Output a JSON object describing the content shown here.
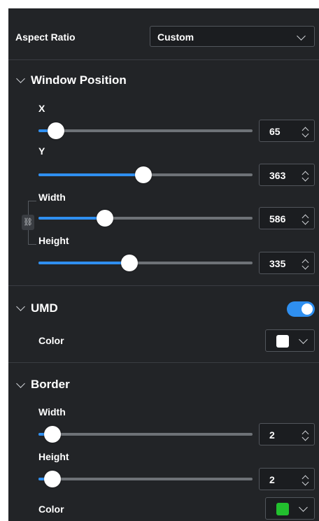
{
  "aspect_ratio": {
    "label": "Aspect Ratio",
    "value": "Custom"
  },
  "window_position": {
    "title": "Window Position",
    "x": {
      "label": "X",
      "value": "65",
      "fraction": 0.06
    },
    "y": {
      "label": "Y",
      "value": "363",
      "fraction": 0.49
    },
    "width": {
      "label": "Width",
      "value": "586",
      "fraction": 0.31
    },
    "height": {
      "label": "Height",
      "value": "335",
      "fraction": 0.42
    }
  },
  "umd": {
    "title": "UMD",
    "enabled": true,
    "color_label": "Color",
    "color": "#ffffff"
  },
  "border": {
    "title": "Border",
    "width": {
      "label": "Width",
      "value": "2",
      "fraction": 0.0
    },
    "height": {
      "label": "Height",
      "value": "2",
      "fraction": 0.0
    },
    "color_label": "Color",
    "color": "#22c02e"
  },
  "colors": {
    "accent": "#2f8ff0",
    "panel_bg": "#222427"
  }
}
